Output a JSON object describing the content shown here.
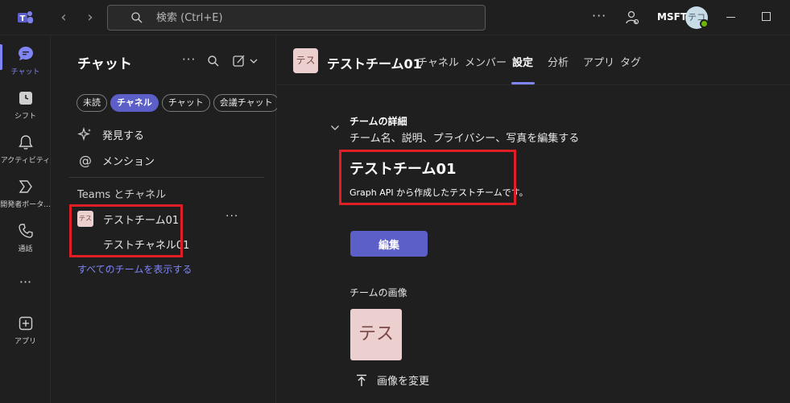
{
  "titlebar": {
    "search_placeholder": "検索 (Ctrl+E)",
    "more": "···",
    "org": "MSFT",
    "avatar_text": "テコ"
  },
  "rail": {
    "items": [
      {
        "label": "チャット",
        "icon": "chat-icon",
        "active": true
      },
      {
        "label": "シフト",
        "icon": "shifts-icon"
      },
      {
        "label": "アクティビティ",
        "icon": "bell-icon"
      },
      {
        "label": "開発者ポータ...",
        "icon": "developer-portal-icon"
      },
      {
        "label": "通話",
        "icon": "phone-icon"
      },
      {
        "label": "···",
        "icon": "more-icon"
      },
      {
        "label": "アプリ",
        "icon": "apps-icon"
      }
    ]
  },
  "pane": {
    "title": "チャット",
    "more": "···",
    "chips": [
      "未読",
      "チャネル",
      "チャット",
      "会議チャット"
    ],
    "discover": "発見する",
    "mentions": "メンション",
    "section": "Teams とチャネル",
    "team_avatar": "テス",
    "team_name": "テストチーム01",
    "team_more": "···",
    "channel_name": "テストチャネル01",
    "show_all": "すべてのチームを表示する"
  },
  "main": {
    "avatar": "テス",
    "title": "テストチーム01",
    "tabs": [
      "チャネル",
      "メンバー",
      "設定",
      "分析",
      "アプリ",
      "タグ"
    ],
    "details_title": "チームの詳細",
    "details_sub": "チーム名、説明、プライバシー、写真を編集する",
    "team_name": "テストチーム01",
    "team_desc": "Graph API から作成したテストチームです。",
    "edit": "編集",
    "image_label": "チームの画像",
    "image_text": "テス",
    "change_image": "画像を変更"
  },
  "colors": {
    "accent": "#5b5fc7",
    "accent_light": "#7f85f5",
    "highlight_box": "#e01e26",
    "background": "#1f1f1f"
  }
}
